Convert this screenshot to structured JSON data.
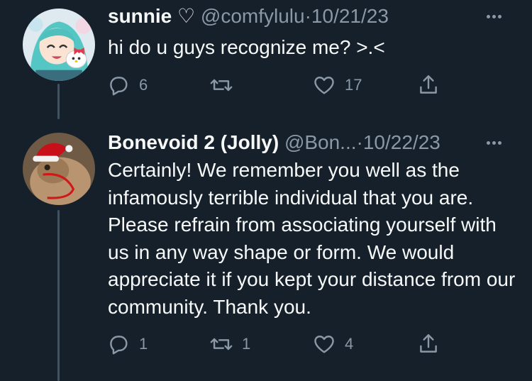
{
  "thread": [
    {
      "display_name": "sunnie ♡",
      "handle": "@comfylulu",
      "separator": "·",
      "date": "10/21/23",
      "text": "hi do u guys recognize me? >.<",
      "reply_count": "6",
      "retweet_count": "",
      "like_count": "17",
      "avatar_icon": "anime-avatar"
    },
    {
      "display_name": "Bonevoid 2 (Jolly)",
      "handle": "@Bon...",
      "separator": "·",
      "date": "10/22/23",
      "text": "Certainly! We remember you well as the infamously terrible individual that you are. Please refrain from associating yourself with us in any way shape or form. We would appreciate it if you kept your distance from our community. Thank you.",
      "reply_count": "1",
      "retweet_count": "1",
      "like_count": "4",
      "avatar_icon": "frog-santa-hat-avatar"
    }
  ],
  "colors": {
    "background": "#15202b",
    "text": "#f7f9f9",
    "secondary": "#8b98a5",
    "thread_line": "#3d5466"
  }
}
